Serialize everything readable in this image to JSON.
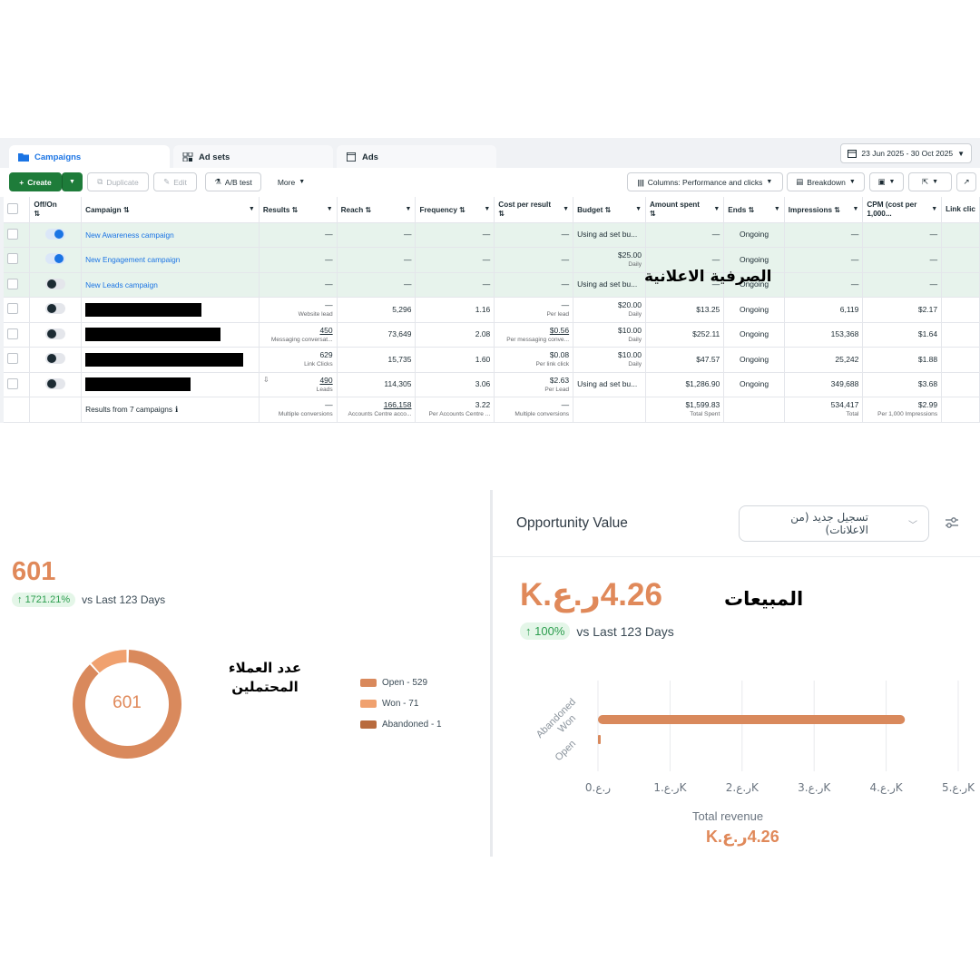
{
  "ads_manager": {
    "tabs": [
      {
        "label": "Campaigns"
      },
      {
        "label": "Ad sets"
      },
      {
        "label": "Ads"
      }
    ],
    "date_range": "23 Jun 2025 - 30 Oct 2025",
    "toolbar": {
      "create": "Create",
      "duplicate": "Duplicate",
      "edit": "Edit",
      "ab_test": "A/B test",
      "more": "More",
      "columns": "Columns: Performance and clicks",
      "breakdown": "Breakdown"
    },
    "columns": {
      "offon": "Off/On",
      "campaign": "Campaign",
      "results": "Results",
      "reach": "Reach",
      "frequency": "Frequency",
      "cpr": "Cost per result",
      "budget": "Budget",
      "amount_spent": "Amount spent",
      "ends": "Ends",
      "impressions": "Impressions",
      "cpm": "CPM (cost per 1,000...",
      "link_clicks": "Link clic"
    },
    "rows": [
      {
        "name": "New Awareness campaign",
        "on": "true",
        "results": "—",
        "results_sub": "",
        "reach": "—",
        "frequency": "—",
        "cpr": "—",
        "cpr_sub": "",
        "budget": "Using ad set bu...",
        "budget_sub": "",
        "spent": "—",
        "ends": "Ongoing",
        "impressions": "—",
        "cpm": "—"
      },
      {
        "name": "New Engagement campaign",
        "on": "true",
        "results": "—",
        "results_sub": "",
        "reach": "—",
        "frequency": "—",
        "cpr": "—",
        "cpr_sub": "",
        "budget": "$25.00",
        "budget_sub": "Daily",
        "spent": "—",
        "ends": "Ongoing",
        "impressions": "—",
        "cpm": "—"
      },
      {
        "name": "New Leads campaign",
        "on": "false",
        "results": "—",
        "results_sub": "",
        "reach": "—",
        "frequency": "—",
        "cpr": "—",
        "cpr_sub": "",
        "budget": "Using ad set bu...",
        "budget_sub": "",
        "spent": "—",
        "ends": "Ongoing",
        "impressions": "—",
        "cpm": "—"
      },
      {
        "name": "",
        "on": "false",
        "results": "—",
        "results_sub": "Website lead",
        "reach": "5,296",
        "frequency": "1.16",
        "cpr": "—",
        "cpr_sub": "Per lead",
        "budget": "$20.00",
        "budget_sub": "Daily",
        "spent": "$13.25",
        "ends": "Ongoing",
        "impressions": "6,119",
        "cpm": "$2.17"
      },
      {
        "name": "",
        "on": "false",
        "results": "450",
        "results_sub": "Messaging conversat...",
        "reach": "73,649",
        "frequency": "2.08",
        "cpr": "$0.56",
        "cpr_sub": "Per messaging conve...",
        "budget": "$10.00",
        "budget_sub": "Daily",
        "spent": "$252.11",
        "ends": "Ongoing",
        "impressions": "153,368",
        "cpm": "$1.64"
      },
      {
        "name": "",
        "on": "false",
        "results": "629",
        "results_sub": "Link Clicks",
        "reach": "15,735",
        "frequency": "1.60",
        "cpr": "$0.08",
        "cpr_sub": "Per link click",
        "budget": "$10.00",
        "budget_sub": "Daily",
        "spent": "$47.57",
        "ends": "Ongoing",
        "impressions": "25,242",
        "cpm": "$1.88"
      },
      {
        "name": "",
        "on": "false",
        "results": "490",
        "results_sub": "Leads",
        "reach": "114,305",
        "frequency": "3.06",
        "cpr": "$2.63",
        "cpr_sub": "Per Lead",
        "budget": "Using ad set bu...",
        "budget_sub": "",
        "spent": "$1,286.90",
        "ends": "Ongoing",
        "impressions": "349,688",
        "cpm": "$3.68"
      }
    ],
    "total": {
      "label": "Results from 7 campaigns",
      "results": "—",
      "results_sub": "Multiple conversions",
      "reach": "166,158",
      "reach_sub": "Accounts Centre acco...",
      "frequency": "3.22",
      "frequency_sub": "Per Accounts Centre ...",
      "cpr": "—",
      "cpr_sub": "Multiple conversions",
      "spent": "$1,599.83",
      "spent_sub": "Total Spent",
      "impressions": "534,417",
      "impressions_sub": "Total",
      "cpm": "$2.99",
      "cpm_sub": "Per 1,000 Impressions"
    },
    "overlay_label": "الصرفية الاعلانية"
  },
  "leads": {
    "total": "601",
    "change": "1721.21%",
    "vs": "vs Last 123 Days",
    "donut_center": "601",
    "label_ar_1": "عدد العملاء",
    "label_ar_2": "المحتملين",
    "legend": [
      {
        "label": "Open - 529",
        "value": 529,
        "color": "#d9895c"
      },
      {
        "label": "Won - 71",
        "value": 71,
        "color": "#f0a16f"
      },
      {
        "label": "Abandoned - 1",
        "value": 1,
        "color": "#b86b3e"
      }
    ]
  },
  "opportunity": {
    "title": "Opportunity Value",
    "select_value": "تسجيل جديد (من الاعلانات)",
    "value": "4.26ر.ع.K",
    "change": "100%",
    "vs": "vs Last 123 Days",
    "label_ar": "المبيعات",
    "total_label": "Total revenue",
    "total_value": "4.26ر.ع.K"
  },
  "chart_data": {
    "type": "bar",
    "orientation": "horizontal",
    "categories": [
      "Abandoned",
      "Won",
      "Open"
    ],
    "values": [
      0,
      4.26,
      0.03
    ],
    "x_ticks": [
      "ر.ع.0",
      "ر.ع.1K",
      "ر.ع.2K",
      "ر.ع.3K",
      "ر.ع.4K",
      "ر.ع.5K"
    ],
    "xlim": [
      0,
      5
    ],
    "xlabel": "",
    "ylabel": "",
    "color": "#d9895c"
  }
}
